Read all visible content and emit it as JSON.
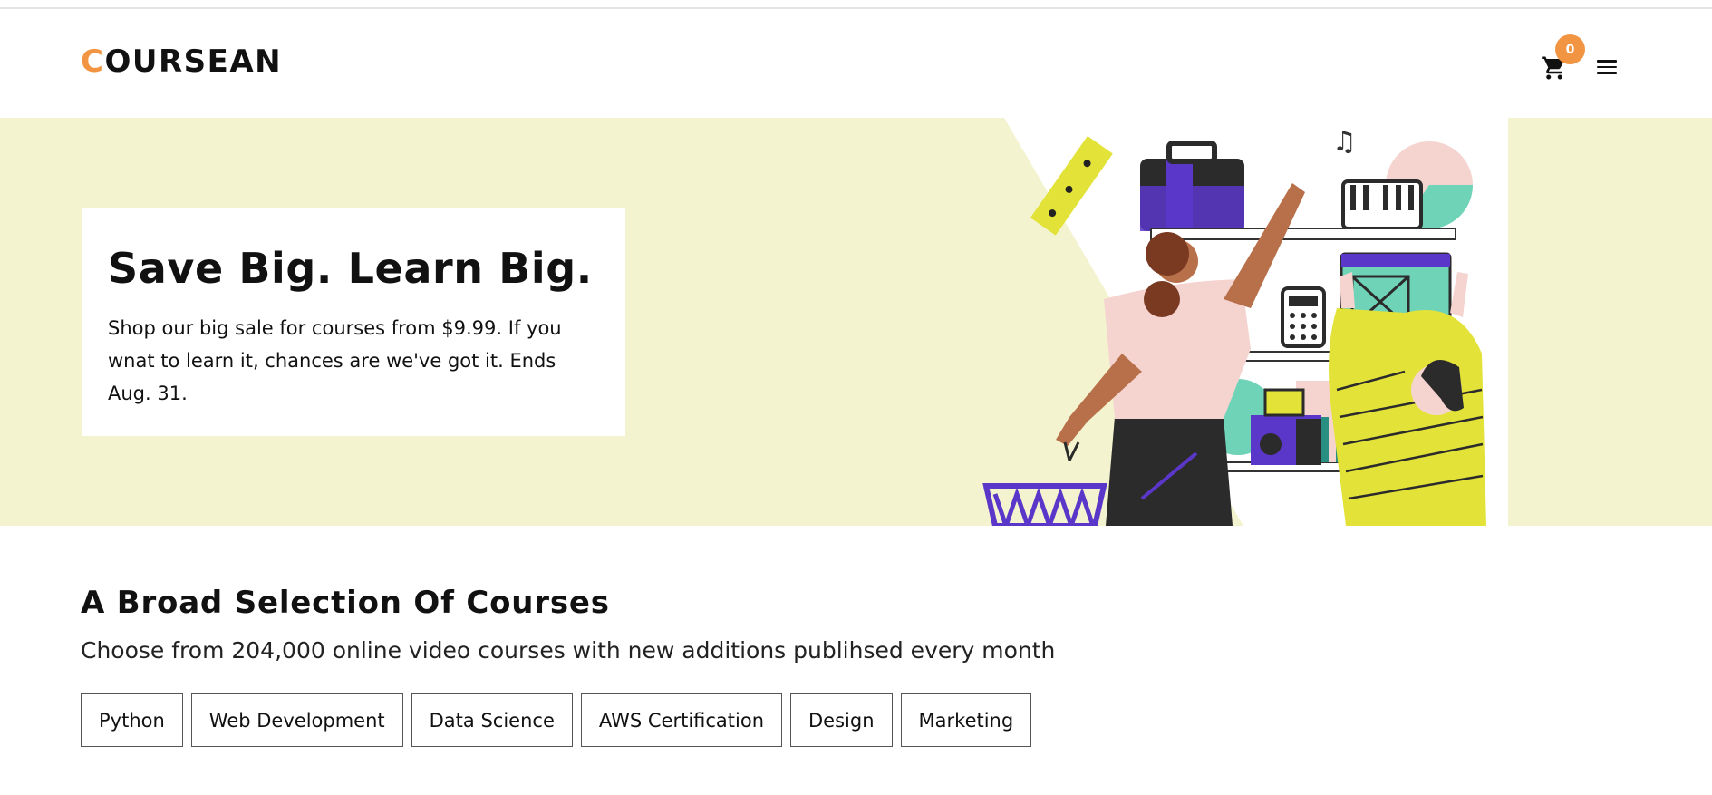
{
  "header": {
    "logo_first_letter": "C",
    "logo_rest": "OURSEAN",
    "cart_count": "0",
    "accent_color": "#f29542"
  },
  "hero": {
    "background_color": "#f3f4cf",
    "title": "Save Big. Learn Big.",
    "description": "Shop our big sale for courses from $9.99. If you wnat to learn it, chances are we've got it. Ends Aug. 31."
  },
  "courses": {
    "title": "A Broad Selection Of Courses",
    "subtitle": "Choose from 204,000 online video courses with new additions publihsed every month",
    "categories": [
      "Python",
      "Web Development",
      "Data Science",
      "AWS Certification",
      "Design",
      "Marketing"
    ]
  }
}
